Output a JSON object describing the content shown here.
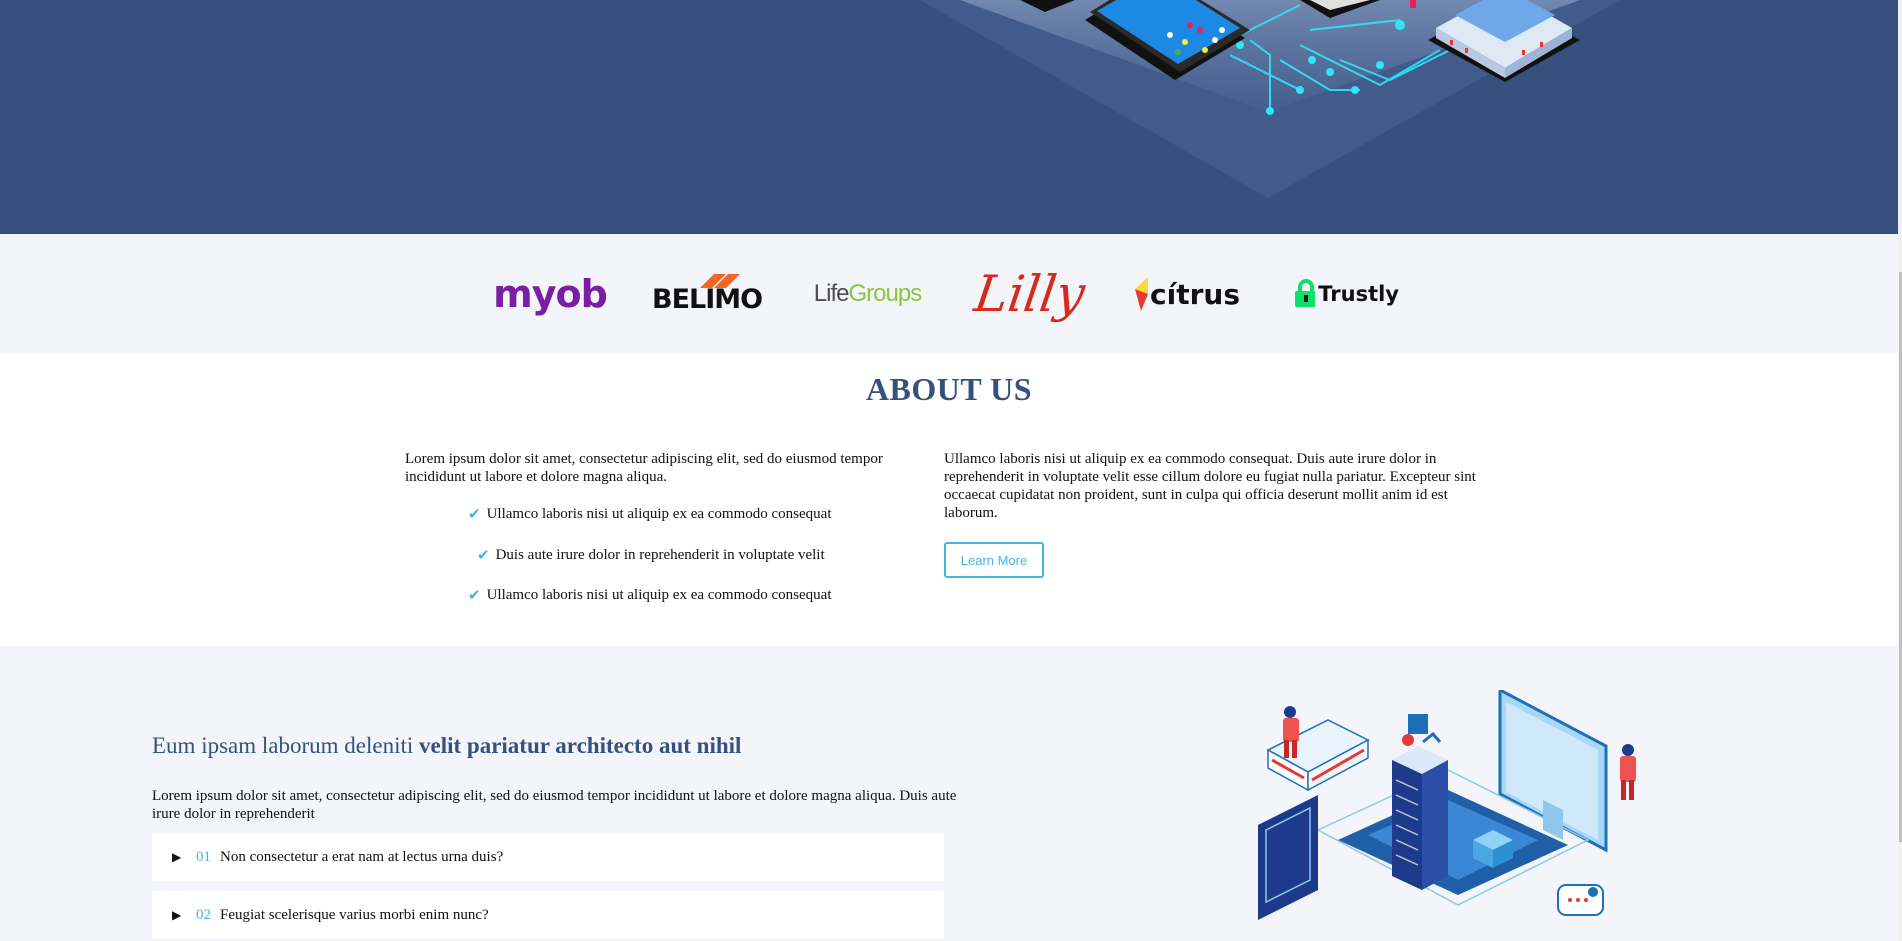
{
  "clients": {
    "logos": [
      {
        "name": "myob",
        "text": "myob",
        "color": "#7b1fa2"
      },
      {
        "name": "belimo",
        "text": "BELIMO",
        "color": "#111111",
        "accent": "#f26522"
      },
      {
        "name": "lifegroups",
        "text_a": "Life",
        "text_b": "Groups",
        "color_a": "#4d4d4d",
        "color_b": "#8cc63f"
      },
      {
        "name": "lilly",
        "text": "Lilly",
        "color": "#d52b1e"
      },
      {
        "name": "citrus",
        "text": "cítrus",
        "color": "#111111"
      },
      {
        "name": "trustly",
        "text": "Trustly",
        "color": "#111111",
        "accent": "#0ee06e"
      }
    ]
  },
  "about": {
    "title": "ABOUT US",
    "left_paragraph": "Lorem ipsum dolor sit amet, consectetur adipiscing elit, sed do eiusmod tempor incididunt ut labore et dolore magna aliqua.",
    "checklist": [
      "Ullamco laboris nisi ut aliquip ex ea commodo consequat",
      "Duis aute irure dolor in reprehenderit in voluptate velit",
      "Ullamco laboris nisi ut aliquip ex ea commodo consequat"
    ],
    "right_paragraph": "Ullamco laboris nisi ut aliquip ex ea commodo consequat. Duis aute irure dolor in reprehenderit in voluptate velit esse cillum dolore eu fugiat nulla pariatur. Excepteur sint occaecat cupidatat non proident, sunt in culpa qui officia deserunt mollit anim id est laborum.",
    "button_label": "Learn More"
  },
  "why": {
    "title_plain": "Eum ipsam laborum deleniti ",
    "title_bold": "velit pariatur architecto aut nihil",
    "description": "Lorem ipsum dolor sit amet, consectetur adipiscing elit, sed do eiusmod tempor incididunt ut labore et dolore magna aliqua. Duis aute irure dolor in reprehenderit",
    "faq": [
      {
        "num": "01",
        "question": "Non consectetur a erat nam at lectus urna duis?"
      },
      {
        "num": "02",
        "question": "Feugiat scelerisque varius morbi enim nunc?"
      }
    ]
  },
  "colors": {
    "primary": "#37517e",
    "accent": "#47b2e4",
    "section_bg": "#f3f5fa"
  }
}
